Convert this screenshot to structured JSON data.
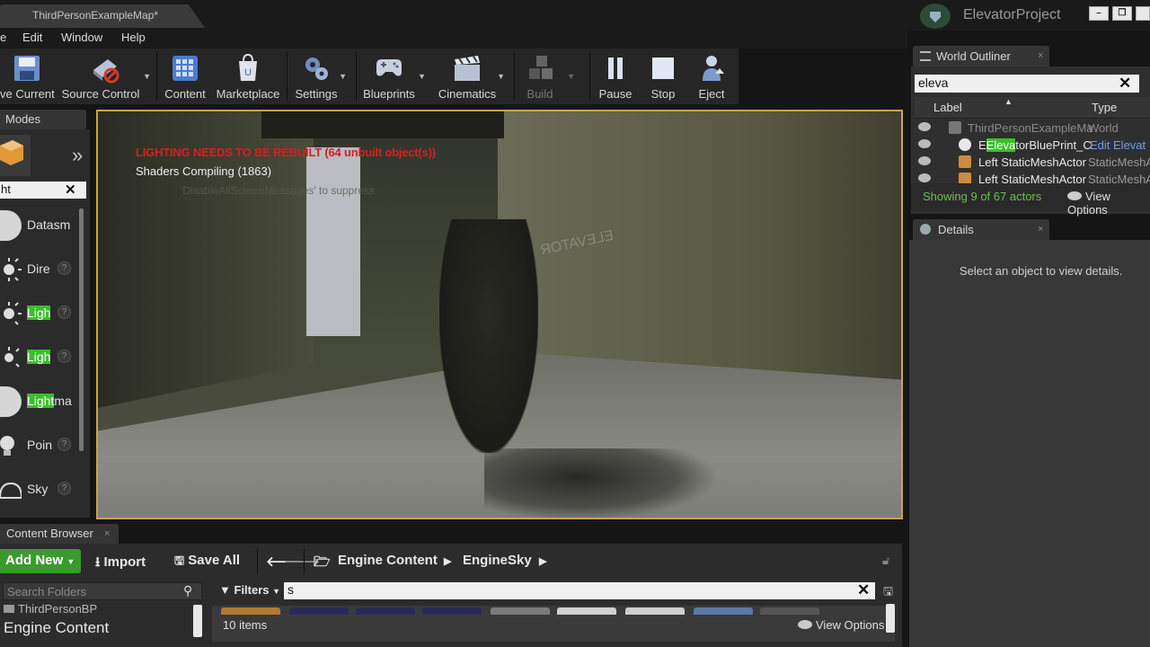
{
  "window": {
    "tab_title": "ThirdPersonExampleMap",
    "tab_modified": "*",
    "project_name": "ElevatorProject",
    "controls": [
      "minimize",
      "maximize"
    ]
  },
  "menu": {
    "items": [
      "e",
      "Edit",
      "Window",
      "Help"
    ]
  },
  "toolbar": {
    "items": [
      {
        "label": "ve Current",
        "icon": "save-icon"
      },
      {
        "label": "Source Control",
        "icon": "source-control-icon"
      },
      {
        "label": "Content",
        "icon": "content-grid-icon"
      },
      {
        "label": "Marketplace",
        "icon": "marketplace-icon"
      },
      {
        "label": "Settings",
        "icon": "gears-icon"
      },
      {
        "label": "Blueprints",
        "icon": "gamepad-icon"
      },
      {
        "label": "Cinematics",
        "icon": "clapperboard-icon"
      },
      {
        "label": "Build",
        "icon": "build-cubes-icon"
      },
      {
        "label": "Pause",
        "icon": "pause-icon"
      },
      {
        "label": "Stop",
        "icon": "stop-icon"
      },
      {
        "label": "Eject",
        "icon": "eject-icon"
      }
    ]
  },
  "modes": {
    "tab_label": "Modes",
    "search_value": "ht",
    "items": [
      {
        "pre": "",
        "hl": "",
        "post": "Datasm"
      },
      {
        "pre": "",
        "hl": "",
        "post": "Dire"
      },
      {
        "pre": "",
        "hl": "Ligh",
        "post": ""
      },
      {
        "pre": "",
        "hl": "Ligh",
        "post": ""
      },
      {
        "pre": "",
        "hl": "Light",
        "post": "ma"
      },
      {
        "pre": "",
        "hl": "",
        "post": "Poin"
      },
      {
        "pre": "",
        "hl": "",
        "post": "Sky"
      }
    ]
  },
  "viewport": {
    "warning": "LIGHTING NEEDS TO BE REBUILT (64 unbuilt object(s))",
    "shaders": "Shaders Compiling (1863)",
    "suppress": "'DisableAllScreenMessages' to suppress",
    "wall_sign": "ELEVATOR"
  },
  "world_outliner": {
    "tab_label": "World Outliner",
    "search_value": "eleva",
    "col_label": "Label",
    "col_type": "Type",
    "rows": [
      {
        "pre": "ThirdPersonExampleMa",
        "hl": "",
        "post": "",
        "type": "World",
        "dim": true
      },
      {
        "pre": "E",
        "hl": "Eleva",
        "post": "torBluePrint_C",
        "type": "Edit Elevat",
        "dim": false
      },
      {
        "pre": "Left StaticMeshActor",
        "hl": "",
        "post": "",
        "type": "StaticMeshA",
        "dim": false
      },
      {
        "pre": "Left StaticMeshActor",
        "hl": "",
        "post": "",
        "type": "StaticMeshA",
        "dim": false
      }
    ],
    "count_text": "Showing 9 of 67 actors",
    "view_options": "View Options"
  },
  "details": {
    "tab_label": "Details",
    "empty_text": "Select an object to view details."
  },
  "content_browser": {
    "tab_label": "Content Browser",
    "add_new": "Add New",
    "import": "Import",
    "save_all": "Save All",
    "path": [
      "Engine Content",
      "EngineSky"
    ],
    "folder_search_placeholder": "Search Folders",
    "folders": [
      "ThirdPersonBP",
      "Engine Content"
    ],
    "filters": "Filters",
    "asset_search_value": "s",
    "item_count": "10 items",
    "view_options": "View Options"
  },
  "colors": {
    "accent_green": "#3bbf2b",
    "viewport_border": "#c6a64a",
    "warning_red": "#d42020"
  }
}
